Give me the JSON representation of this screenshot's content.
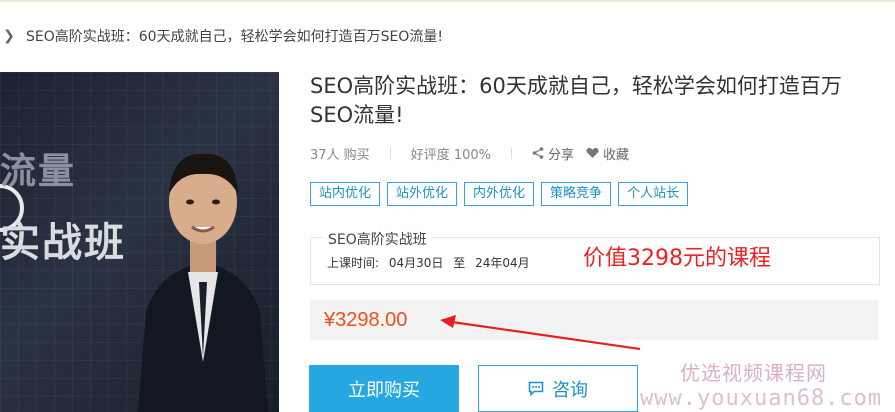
{
  "breadcrumb": {
    "current": "SEO高阶实战班：60天成就自己，轻松学会如何打造百万SEO流量!"
  },
  "hero": {
    "line1": "流量",
    "line2": "实战班"
  },
  "course": {
    "title": "SEO高阶实战班：60天成就自己，轻松学会如何打造百万SEO流量!",
    "buyers": "37人 购买",
    "rating": "好评度 100%",
    "share_label": "分享",
    "favorite_label": "收藏",
    "tags": [
      "站内优化",
      "站外优化",
      "内外优化",
      "策略竞争",
      "个人站长"
    ]
  },
  "class_info": {
    "name": "SEO高阶实战班",
    "time_label": "上课时间:",
    "start": "04月30日",
    "to": "至",
    "end": "24年04月"
  },
  "annotation": "价值3298元的课程",
  "price": "¥3298.00",
  "actions": {
    "buy_label": "立即购买",
    "consult_label": "咨询"
  },
  "watermark": {
    "cn": "优选视频课程网",
    "url": "www.youxuan68.com"
  },
  "icons": {
    "breadcrumb": "chevron-right-icon",
    "share": "share-icon",
    "favorite": "heart-icon",
    "consult": "chat-bubble-icon"
  },
  "colors": {
    "accent": "#27a7e2",
    "price": "#e8521d",
    "annotation": "#f0201f"
  }
}
